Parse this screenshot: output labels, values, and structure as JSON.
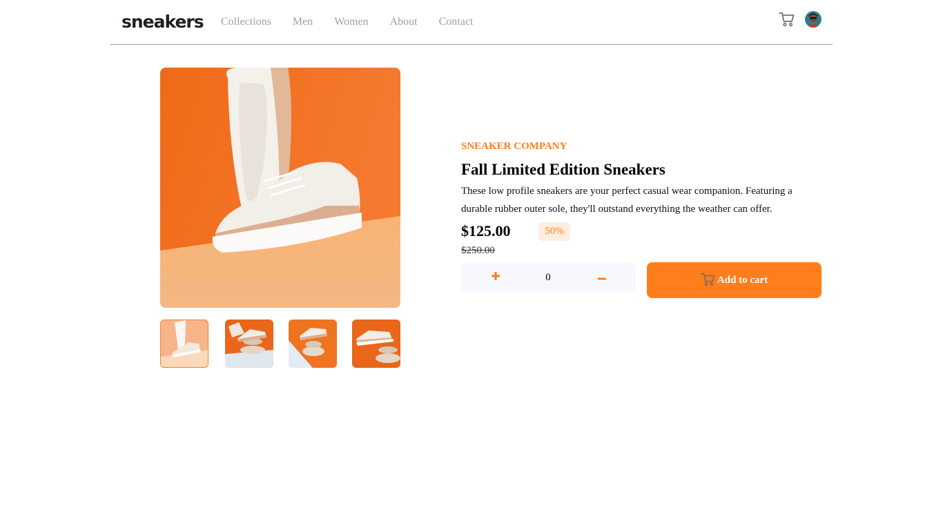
{
  "header": {
    "logo": "sneakers",
    "nav": [
      "Collections",
      "Men",
      "Women",
      "About",
      "Contact"
    ]
  },
  "product": {
    "company": "SNEAKER COMPANY",
    "title": "Fall Limited Edition Sneakers",
    "description": "These low profile sneakers are your perfect casual wear companion. Featuring a durable rubber outer sole, they'll outstand everything the weather can offer.",
    "price": "$125.00",
    "discount": "50%",
    "original_price": "$250.00",
    "quantity": "0",
    "add_to_cart_label": "Add to cart"
  },
  "icons": {
    "cart": "cart-icon",
    "plus": "plus-icon",
    "minus": "minus-icon",
    "avatar": "avatar"
  },
  "colors": {
    "accent": "#ff7e1b",
    "accent_pale": "#ffede0",
    "muted_text": "#9aa0a8",
    "dark": "#1d2025"
  }
}
